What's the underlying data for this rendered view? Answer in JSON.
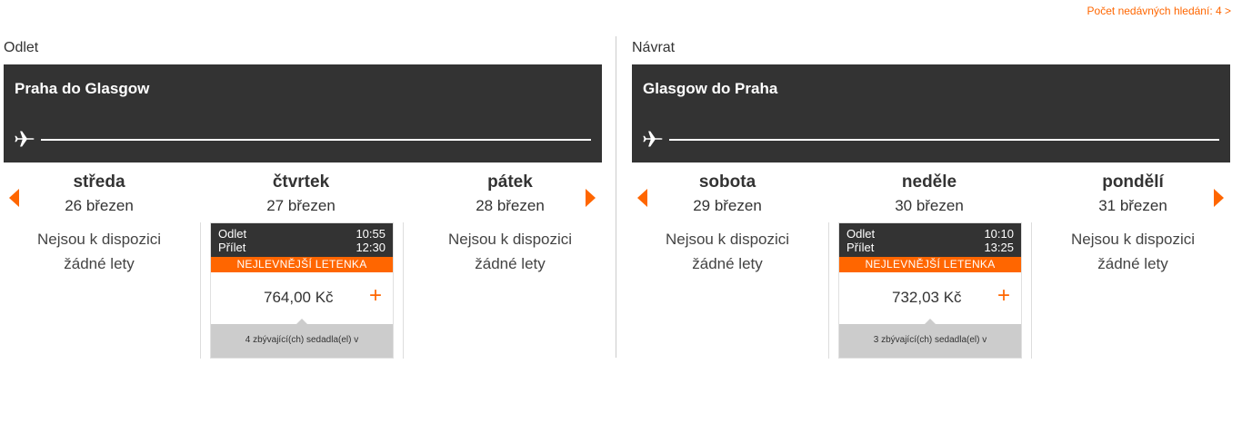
{
  "recent_searches": "Počet nedávných hledání: 4 >",
  "outbound": {
    "label": "Odlet",
    "route": "Praha do Glasgow",
    "days": [
      {
        "name": "středa",
        "date": "26 březen",
        "no_flights_1": "Nejsou k dispozici",
        "no_flights_2": "žádné lety"
      },
      {
        "name": "čtvrtek",
        "date": "27 březen",
        "flight": {
          "depart_label": "Odlet",
          "depart_time": "10:55",
          "arrive_label": "Přílet",
          "arrive_time": "12:30",
          "badge": "NEJLEVNĚJŠÍ LETENKA",
          "price": "764,00 Kč",
          "add": "+",
          "seats": "4 zbývající(ch) sedadla(el) v"
        }
      },
      {
        "name": "pátek",
        "date": "28 březen",
        "no_flights_1": "Nejsou k dispozici",
        "no_flights_2": "žádné lety"
      }
    ]
  },
  "return": {
    "label": "Návrat",
    "route": "Glasgow do Praha",
    "days": [
      {
        "name": "sobota",
        "date": "29 březen",
        "no_flights_1": "Nejsou k dispozici",
        "no_flights_2": "žádné lety"
      },
      {
        "name": "neděle",
        "date": "30 březen",
        "flight": {
          "depart_label": "Odlet",
          "depart_time": "10:10",
          "arrive_label": "Přílet",
          "arrive_time": "13:25",
          "badge": "NEJLEVNĚJŠÍ LETENKA",
          "price": "732,03 Kč",
          "add": "+",
          "seats": "3 zbývající(ch) sedadla(el) v"
        }
      },
      {
        "name": "pondělí",
        "date": "31 březen",
        "no_flights_1": "Nejsou k dispozici",
        "no_flights_2": "žádné lety"
      }
    ]
  },
  "icons": {
    "plane": "plane-icon",
    "prev": "arrow-left-icon",
    "next": "arrow-right-icon"
  },
  "colors": {
    "accent": "#ff6600",
    "banner": "#333333"
  }
}
